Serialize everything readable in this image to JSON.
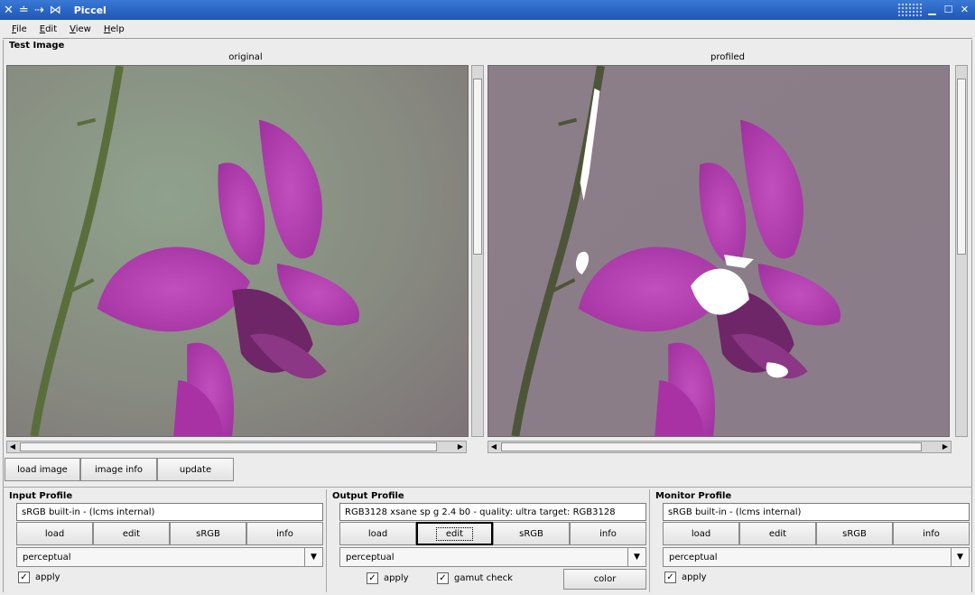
{
  "window": {
    "title": "Piccel"
  },
  "menubar": {
    "items": [
      "File",
      "Edit",
      "View",
      "Help"
    ]
  },
  "test_image": {
    "title": "Test Image",
    "original_label": "original",
    "profiled_label": "profiled"
  },
  "image_buttons": {
    "load_image": "load image",
    "image_info": "image info",
    "update": "update"
  },
  "input_profile": {
    "title": "Input Profile",
    "profile": "sRGB built-in - (lcms internal)",
    "buttons": [
      "load",
      "edit",
      "sRGB",
      "info"
    ],
    "intent": "perceptual",
    "apply_label": "apply",
    "apply_checked": true
  },
  "output_profile": {
    "title": "Output Profile",
    "profile": "RGB3128 xsane sp g 2.4 b0 - quality: ultra  target: RGB3128",
    "buttons": [
      "load",
      "edit",
      "sRGB",
      "info"
    ],
    "intent": "perceptual",
    "apply_label": "apply",
    "apply_checked": true,
    "gamut_label": "gamut check",
    "gamut_checked": true,
    "color_label": "color"
  },
  "monitor_profile": {
    "title": "Monitor Profile",
    "profile": "sRGB built-in - (lcms internal)",
    "buttons": [
      "load",
      "edit",
      "sRGB",
      "info"
    ],
    "intent": "perceptual",
    "apply_label": "apply",
    "apply_checked": true
  },
  "colors": {
    "titlebar": "#2a66c8",
    "orchid": "#b33bb0",
    "background_original": "#8a9a86",
    "background_profiled": "#8e7f8a"
  }
}
